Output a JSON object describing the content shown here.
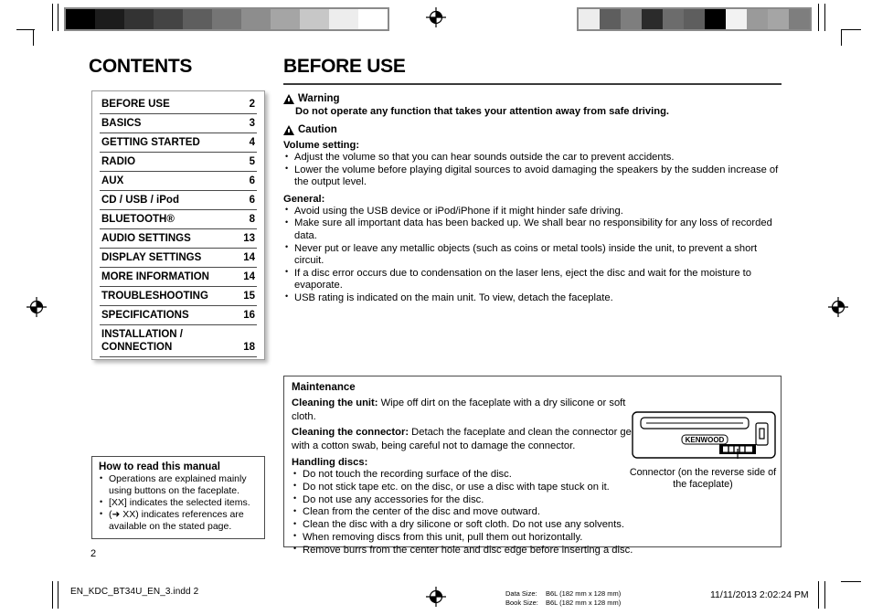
{
  "proof": {
    "colorbar_left": [
      "#000000",
      "#1c1c1c",
      "#333333",
      "#444444",
      "#5e5e5e",
      "#757575",
      "#8d8d8d",
      "#a5a5a5",
      "#c7c7c7",
      "#ededed",
      "#ffffff"
    ],
    "colorbar_right": [
      "#ededed",
      "#5e5e5e",
      "#7e7e7e",
      "#2b2b2b",
      "#6c6c6c",
      "#5e5e5e",
      "#000000",
      "#f2f2f2",
      "#9a9a9a",
      "#a5a5a5",
      "#7e7e7e"
    ],
    "registration_icon": "registration-target-icon"
  },
  "page": {
    "number": "2"
  },
  "contents": {
    "title": "CONTENTS",
    "rows": [
      {
        "label": "BEFORE USE",
        "page": "2"
      },
      {
        "label": "BASICS",
        "page": "3"
      },
      {
        "label": "GETTING STARTED",
        "page": "4"
      },
      {
        "label": "RADIO",
        "page": "5"
      },
      {
        "label": "AUX",
        "page": "6"
      },
      {
        "label": "CD / USB / iPod",
        "page": "6"
      },
      {
        "label": "BLUETOOTH®",
        "page": "8"
      },
      {
        "label": "AUDIO SETTINGS",
        "page": "13"
      },
      {
        "label": "DISPLAY SETTINGS",
        "page": "14"
      },
      {
        "label": "MORE INFORMATION",
        "page": "14"
      },
      {
        "label": "TROUBLESHOOTING",
        "page": "15"
      },
      {
        "label": "SPECIFICATIONS",
        "page": "16"
      },
      {
        "label": "INSTALLATION / CONNECTION",
        "page": "18"
      }
    ]
  },
  "how_to_read": {
    "title": "How to read this manual",
    "items": [
      "Operations are explained mainly using buttons on the faceplate.",
      "[XX] indicates the selected items.",
      "(➜ XX) indicates references are available on the stated page."
    ]
  },
  "before_use": {
    "title": "BEFORE USE",
    "warning": {
      "heading": "Warning",
      "text": "Do not operate any function that takes your attention away from safe driving."
    },
    "caution": {
      "heading": "Caution",
      "groups": [
        {
          "name": "Volume setting:",
          "items": [
            "Adjust the volume so that you can hear sounds outside the car to prevent accidents.",
            "Lower the volume before playing digital sources to avoid damaging the speakers by the sudden increase of the output level."
          ]
        },
        {
          "name": "General:",
          "items": [
            "Avoid using the USB device or iPod/iPhone if it might hinder safe driving.",
            "Make sure all important data has been backed up. We shall bear no responsibility for any loss of recorded data.",
            "Never put or leave any metallic objects (such as coins or metal tools) inside the unit, to prevent a short circuit.",
            "If a disc error occurs due to condensation on the laser lens, eject the disc and wait for the moisture to evaporate.",
            "USB rating is indicated on the main unit. To view, detach the faceplate."
          ]
        }
      ]
    }
  },
  "maintenance": {
    "title": "Maintenance",
    "cleaning_unit_label": "Cleaning the unit:",
    "cleaning_unit_text": " Wipe off dirt on the faceplate with a dry silicone or soft cloth.",
    "cleaning_connector_label": "Cleaning the connector:",
    "cleaning_connector_text": " Detach the faceplate and clean the connector gently with a cotton swab, being careful not to damage the connector.",
    "handling_label": "Handling discs:",
    "handling_items": [
      "Do not touch the recording surface of the disc.",
      "Do not stick tape etc. on the disc, or use a disc with tape stuck on it.",
      "Do not use any accessories for the disc.",
      "Clean from the center of the disc and move outward.",
      "Clean the disc with a dry silicone or soft cloth. Do not use any solvents.",
      "When removing discs from this unit, pull them out horizontally.",
      "Remove burrs from the center hole and disc edge before inserting a disc."
    ],
    "figure": {
      "brand_label": "KENWOOD",
      "caption": "Connector (on the reverse side of the faceplate)"
    }
  },
  "footer": {
    "filename": "EN_KDC_BT34U_EN_3.indd   2",
    "data_size_label": "Data Size:",
    "data_size_value": "B6L (182 mm x 128 mm)",
    "book_size_label": "Book Size:",
    "book_size_value": "B6L (182 mm x 128 mm)",
    "timestamp": "11/11/2013   2:02:24 PM"
  }
}
